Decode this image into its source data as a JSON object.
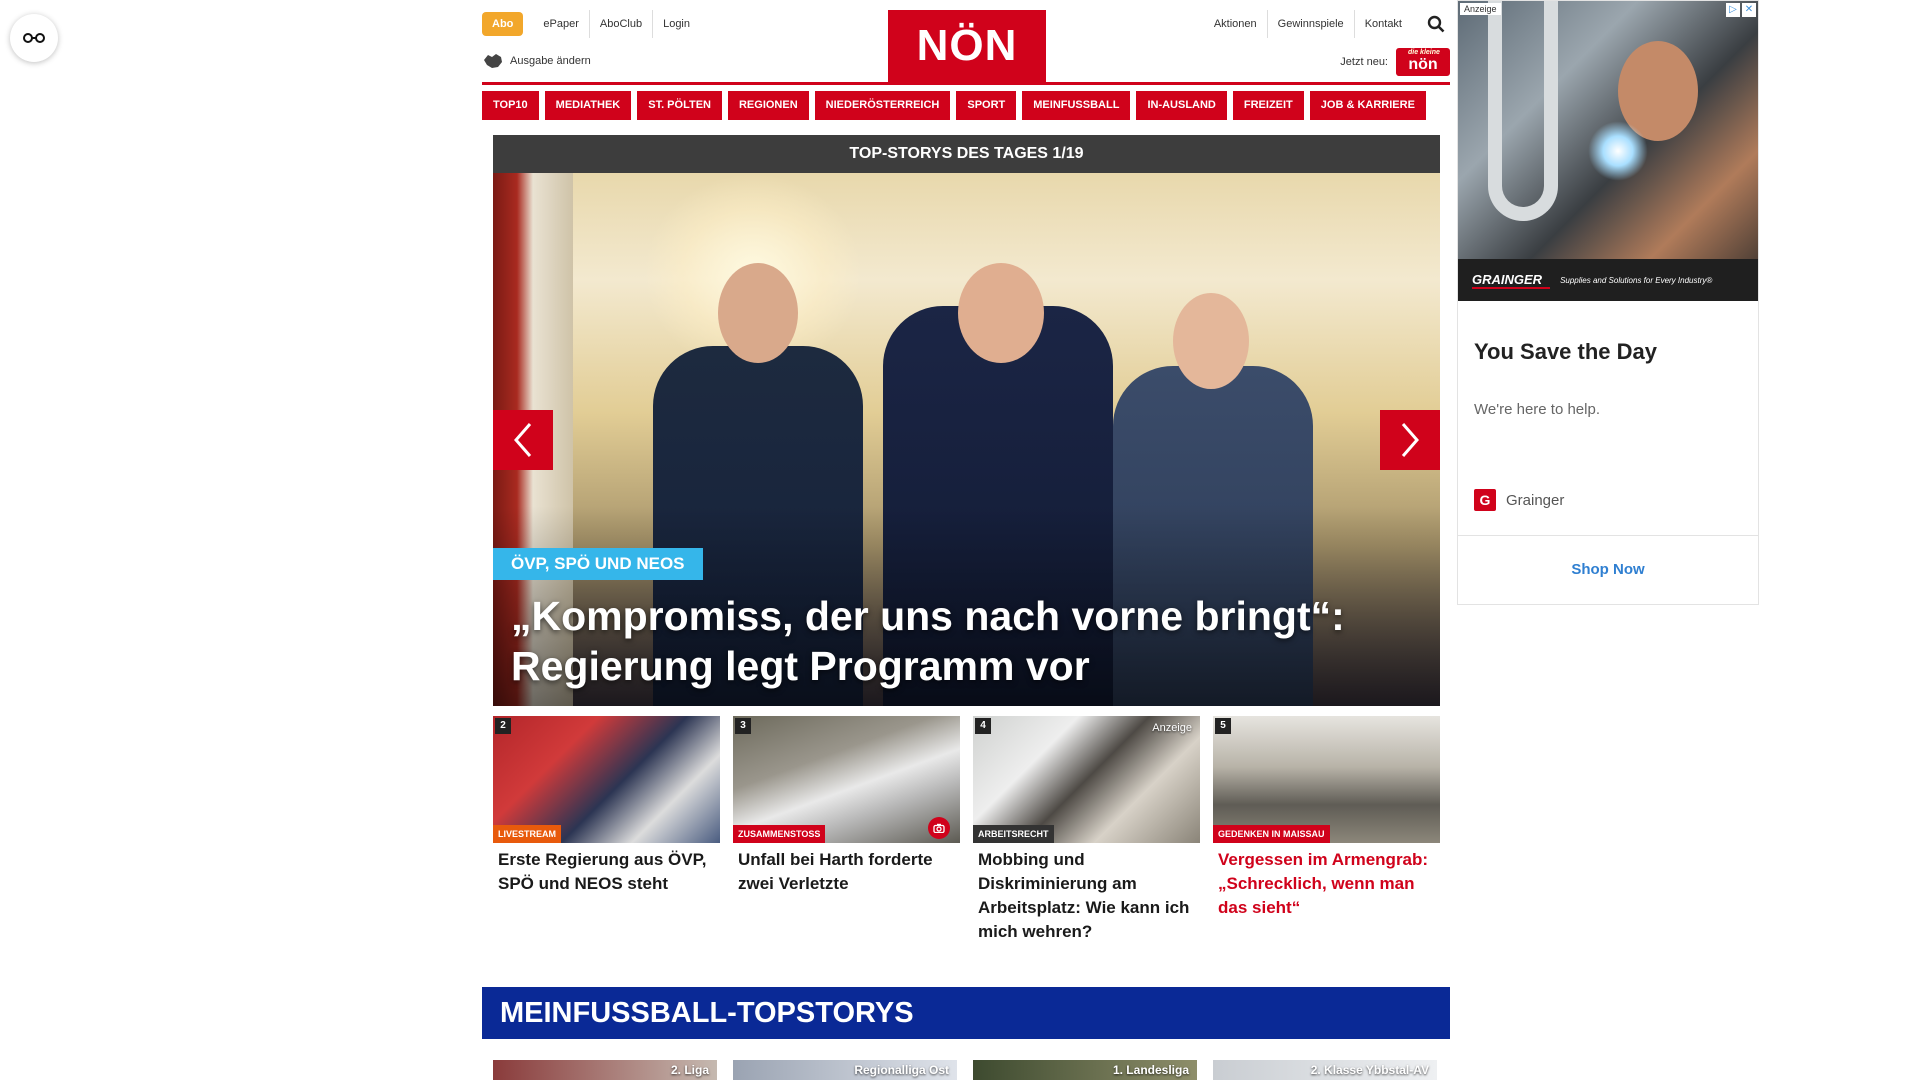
{
  "header": {
    "abo_label": "Abo",
    "links_left": [
      "ePaper",
      "AboClub",
      "Login"
    ],
    "edition_label": "Ausgabe ändern",
    "logo_text": "NÖN",
    "links_right": [
      "Aktionen",
      "Gewinnspiele",
      "Kontakt"
    ],
    "jetzt_neu_label": "Jetzt neu:",
    "mini_logo_text": "nön",
    "mini_logo_script": "die kleine"
  },
  "nav": {
    "items": [
      "TOP10",
      "MEDIATHEK",
      "ST. PÖLTEN",
      "REGIONEN",
      "NIEDERÖSTERREICH",
      "SPORT",
      "MEINFUSSBALL",
      "IN-AUSLAND",
      "FREIZEIT",
      "JOB & KARRIERE"
    ]
  },
  "hero": {
    "heading": "TOP-STORYS DES TAGES 1/19",
    "tag": "ÖVP, SPÖ UND NEOS",
    "title": "„Kompromiss, der uns nach vorne bringt“: Regierung legt Programm vor"
  },
  "stories": [
    {
      "number": "2",
      "kicker": "LIVESTREAM",
      "title": "Erste Regierung aus ÖVP, SPÖ und NEOS steht"
    },
    {
      "number": "3",
      "kicker": "ZUSAMMENSTOSS",
      "title": "Unfall bei Harth forderte zwei Verletzte"
    },
    {
      "number": "4",
      "kicker": "ARBEITSRECHT",
      "title": "Mobbing und Diskriminierung am Arbeitsplatz: Wie kann ich mich wehren?",
      "ad_label": "Anzeige"
    },
    {
      "number": "5",
      "kicker": "GEDENKEN IN MAISSAU",
      "title": "Vergessen im Armengrab: „Schrecklich, wenn man das sieht“"
    }
  ],
  "fussball": {
    "heading": "MEINFUSSBALL-TOPSTORYS",
    "cards": [
      "2. Liga",
      "Regionalliga Ost",
      "1. Landesliga",
      "2. Klasse Ybbstal-AV"
    ]
  },
  "ad": {
    "label": "Anzeige",
    "brand": "GRAINGER",
    "tagline": "Supplies and Solutions for Every Industry®",
    "headline": "You Save the Day",
    "subline": "We're here to help.",
    "sponsor": "Grainger",
    "cta": "Shop Now"
  },
  "colors": {
    "brand_red": "#d0021b",
    "abo_orange": "#f2a72b",
    "hero_tag_blue": "#35b6ea",
    "fussball_blue": "#0a2996",
    "ad_cta_blue": "#2f7fd1"
  }
}
